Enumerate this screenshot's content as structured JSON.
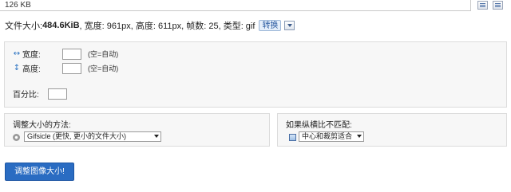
{
  "top": {
    "size_text": "126 KB"
  },
  "info": {
    "prefix": "文件大小: ",
    "file_size": "484.6KiB",
    "details": ", 宽度: 961px, 高度: 611px, 帧数: 25, 类型: gif",
    "convert_label": "转换"
  },
  "resize": {
    "width_label": "宽度:",
    "height_label": "高度:",
    "width_hint": "(空=自动)",
    "height_hint": "(空=自动)",
    "percent_label": "百分比:"
  },
  "method": {
    "label": "调整大小的方法:",
    "selected": "Gifsicle (更快, 更小的文件大小)"
  },
  "aspect": {
    "label": "如果纵横比不匹配:",
    "selected": "中心和裁剪适合"
  },
  "submit_label": "调整图像大小!"
}
